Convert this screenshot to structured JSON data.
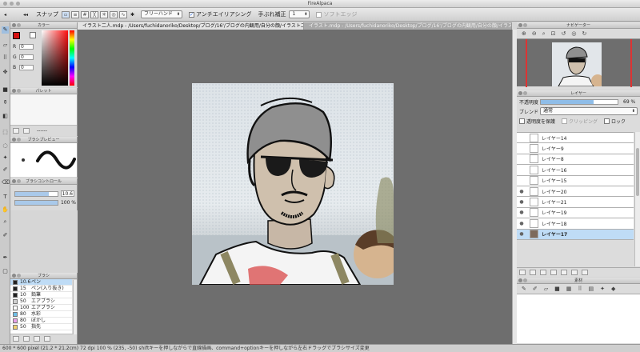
{
  "app": {
    "title": "FireAlpaca"
  },
  "toolbar": {
    "snap_label": "スナップ",
    "mode_select": "フリーハンド",
    "antialias_label": "アンチエイリアシング",
    "correction_label": "手ぶれ補正",
    "correction_value": "1",
    "soft_edge_label": "ソフトエッジ"
  },
  "tabs": [
    {
      "label": "イラスト二人.mdp - /Users/fuchidanoriko/Desktop/ブログ/16'/ブログの内観用/自分の顔/イラスト二人..."
    },
    {
      "label": "イラスト.mdp - /Users/fuchidanoriko/Desktop/ブログ/16'/ブログの内観用/自分の顔/イラスト..."
    }
  ],
  "color_panel": {
    "title": "カラー",
    "r_label": "R",
    "r": "0",
    "g_label": "G",
    "g": "0",
    "b_label": "B",
    "b": "0",
    "primary": "#d41010"
  },
  "palette_panel": {
    "title": "パレット",
    "placeholder": "------"
  },
  "brush_preview": {
    "title": "ブラシプレビュー"
  },
  "brush_control": {
    "title": "ブラシコントロール",
    "size": "10.6",
    "opacity": "100 %",
    "size_fill": 0.8,
    "opacity_fill": 1.0
  },
  "brush_panel": {
    "title": "ブラシ",
    "items": [
      {
        "size": "10.6",
        "name": "ペン",
        "color": "#222222",
        "selected": true
      },
      {
        "size": "15",
        "name": "ペン(入り抜き)",
        "color": "#222222"
      },
      {
        "size": "10",
        "name": "鉛筆",
        "color": "#222222"
      },
      {
        "size": "50",
        "name": "エアブラシ",
        "color": "#d0d0d0"
      },
      {
        "size": "100",
        "name": "エアブラシ",
        "color": "#ffffff"
      },
      {
        "size": "80",
        "name": "水彩",
        "color": "#6ec0e8"
      },
      {
        "size": "80",
        "name": "ぼかし",
        "color": "#e8a0e8"
      },
      {
        "size": "50",
        "name": "指先",
        "color": "#f0d070"
      }
    ]
  },
  "navigator": {
    "title": "ナビゲーター"
  },
  "layer_panel": {
    "title": "レイヤー",
    "opacity_label": "不透明度",
    "opacity_value": "69 %",
    "opacity_fill": 0.69,
    "blend_label": "ブレンド",
    "blend_value": "通常",
    "protect_alpha": "透明度を保護",
    "clipping": "クリッピング",
    "lock": "ロック",
    "layers": [
      {
        "name": "レイヤー14",
        "visible": false
      },
      {
        "name": "レイヤー9",
        "visible": false
      },
      {
        "name": "レイヤー8",
        "visible": false
      },
      {
        "name": "レイヤー16",
        "visible": false
      },
      {
        "name": "レイヤー15",
        "visible": false
      },
      {
        "name": "レイヤー20",
        "visible": true
      },
      {
        "name": "レイヤー21",
        "visible": true
      },
      {
        "name": "レイヤー19",
        "visible": true
      },
      {
        "name": "レイヤー18",
        "visible": true
      },
      {
        "name": "レイヤー17",
        "visible": true,
        "selected": true
      }
    ]
  },
  "material_panel": {
    "title": "素材"
  },
  "status": {
    "text": "600 * 600 pixel  (21.2 * 21.2cm)  72 dpi   100 %  (235, -50)   shiftキーを押しながらで直線描画、command+optionキーを押しながら左右ドラッグでブラシサイズ変更"
  }
}
